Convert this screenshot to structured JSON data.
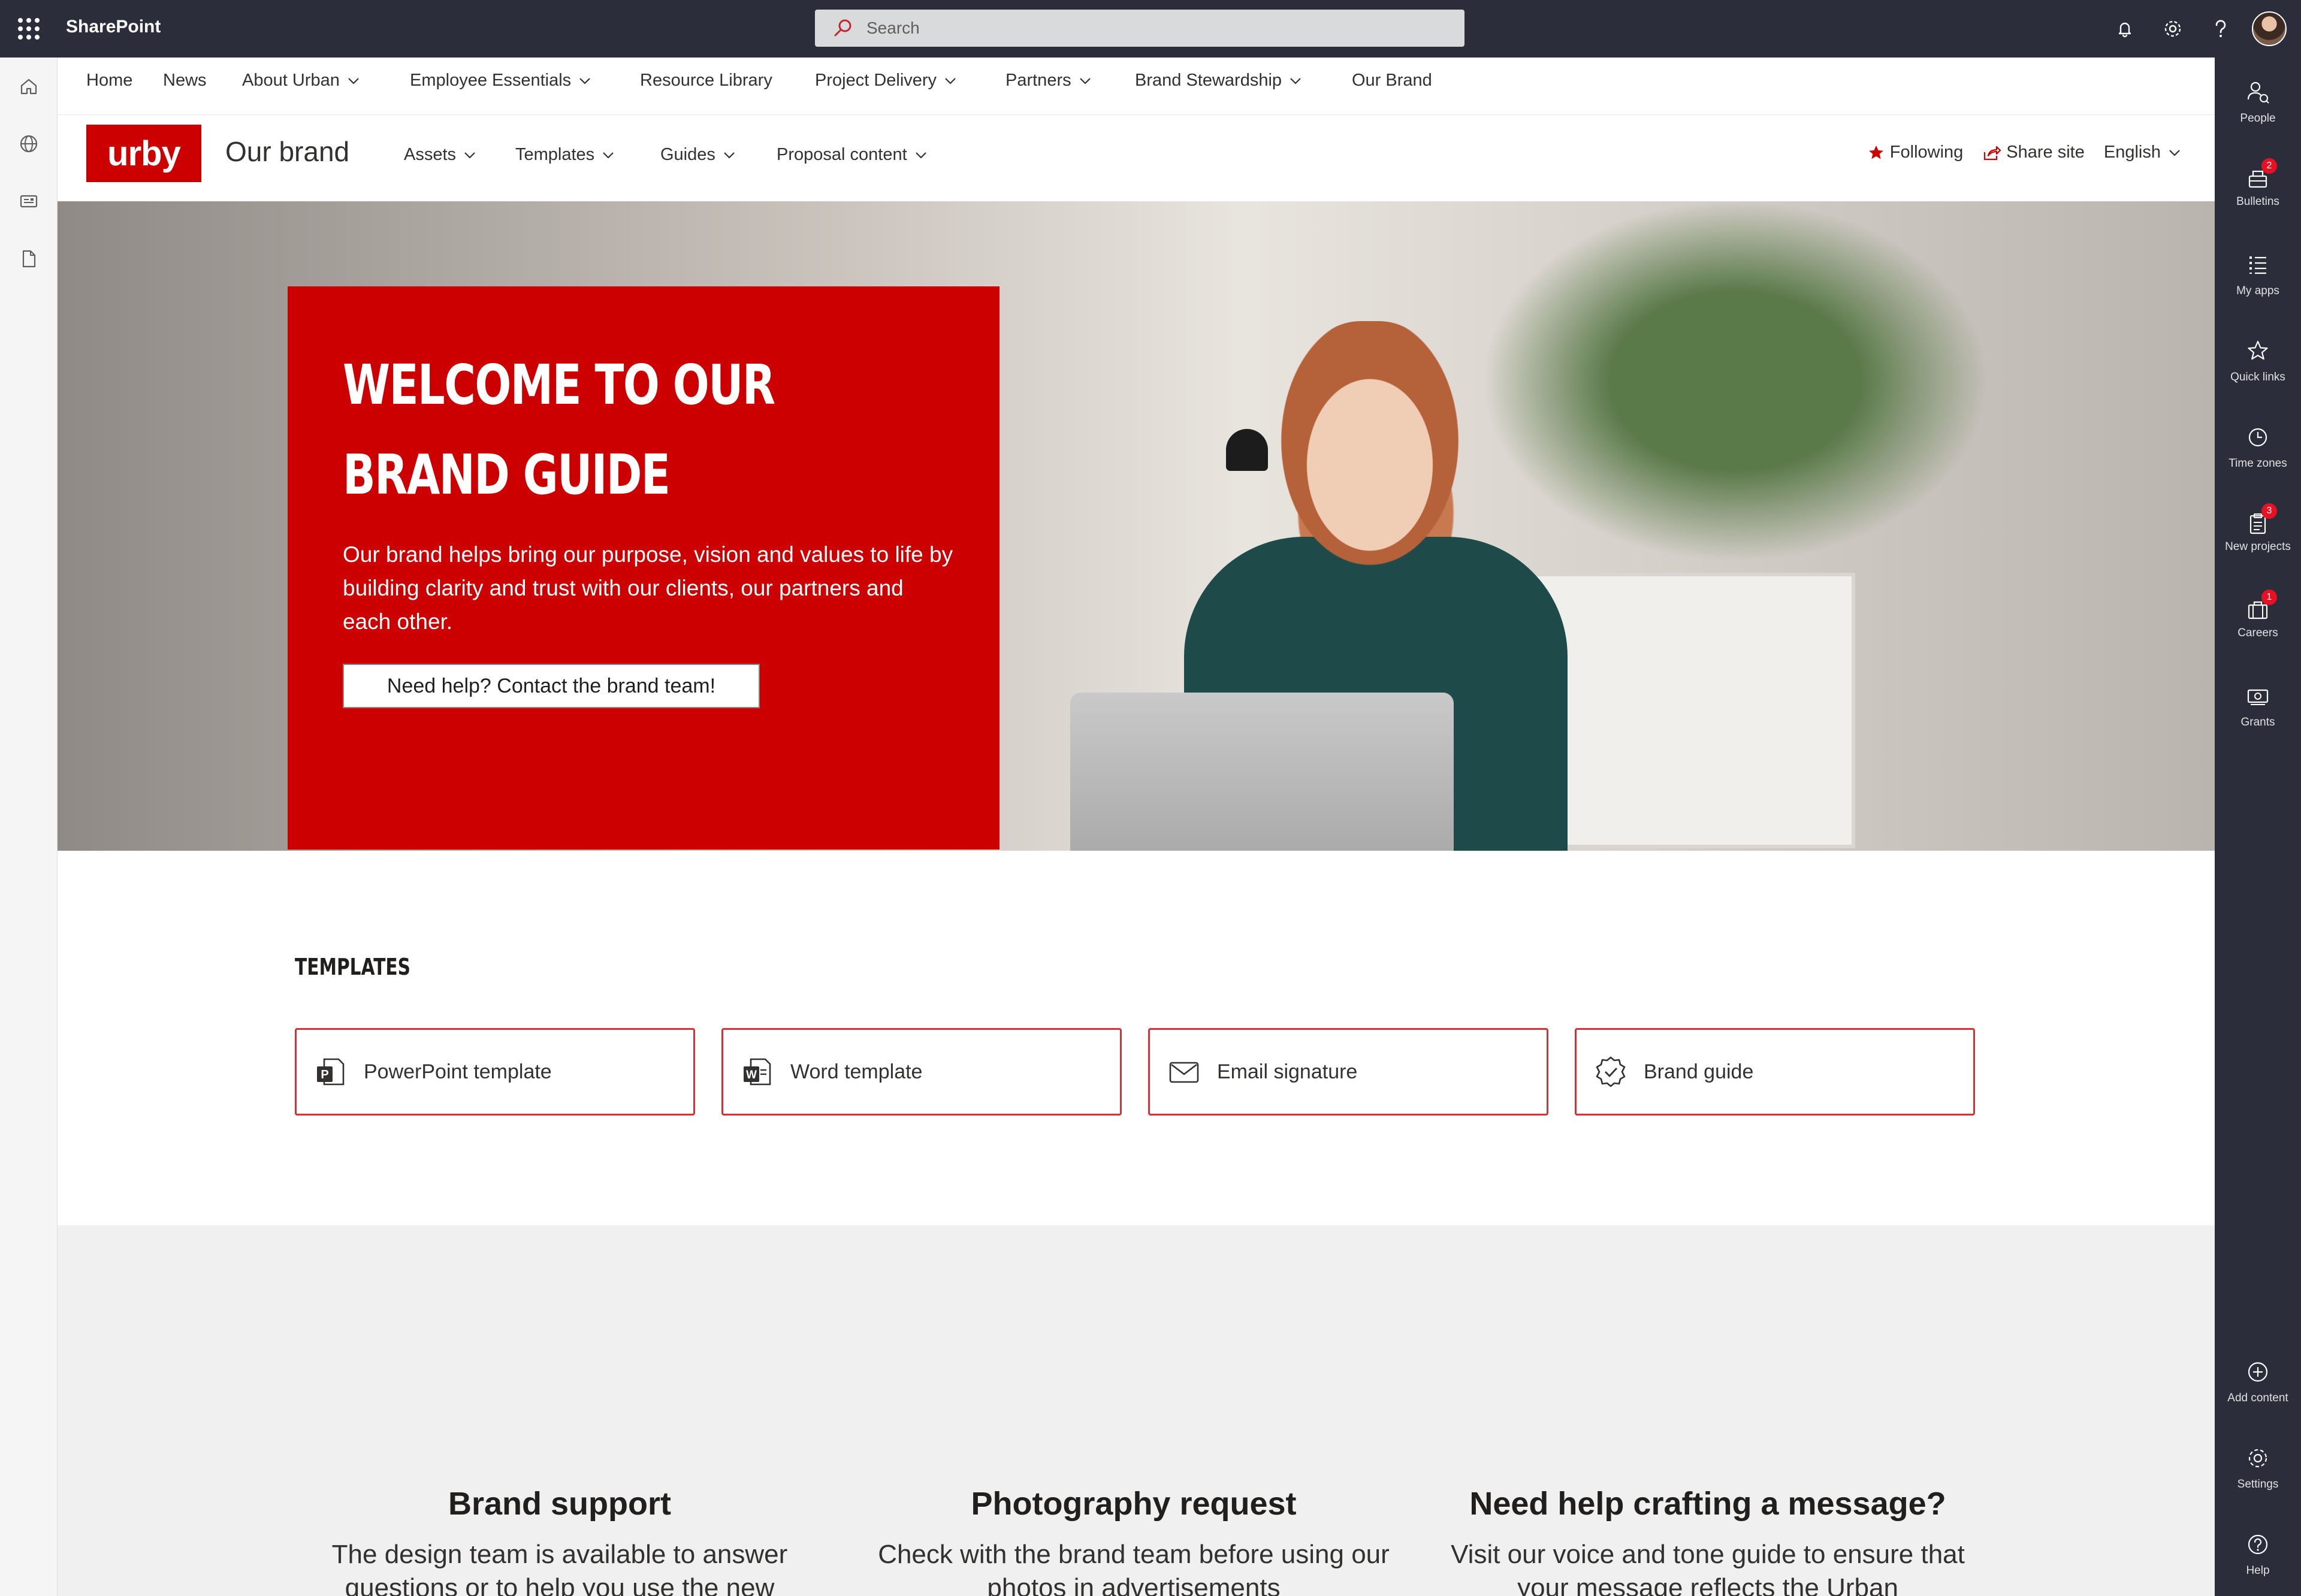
{
  "suite": {
    "app_name": "SharePoint",
    "search_placeholder": "Search"
  },
  "hub_nav": {
    "items": [
      {
        "label": "Home",
        "has_dropdown": false
      },
      {
        "label": "News",
        "has_dropdown": false
      },
      {
        "label": "About Urban",
        "has_dropdown": true
      },
      {
        "label": "Employee Essentials",
        "has_dropdown": true
      },
      {
        "label": "Resource Library",
        "has_dropdown": false
      },
      {
        "label": "Project Delivery",
        "has_dropdown": true
      },
      {
        "label": "Partners",
        "has_dropdown": true
      },
      {
        "label": "Brand Stewardship",
        "has_dropdown": true
      },
      {
        "label": "Our Brand",
        "has_dropdown": false
      }
    ]
  },
  "site": {
    "logo_text": "urby",
    "title": "Our brand",
    "nav": [
      {
        "label": "Assets"
      },
      {
        "label": "Templates"
      },
      {
        "label": "Guides"
      },
      {
        "label": "Proposal content"
      }
    ],
    "following_label": "Following",
    "share_label": "Share site",
    "language_label": "English"
  },
  "hero": {
    "title": "WELCOME TO OUR BRAND GUIDE",
    "text": "Our brand helps bring our purpose, vision and values to life by building clarity and trust with our clients, our partners and each other.",
    "button_label": "Need help? Contact the brand team!"
  },
  "templates": {
    "title": "TEMPLATES",
    "cards": [
      {
        "label": "PowerPoint template",
        "icon": "powerpoint-icon"
      },
      {
        "label": "Word template",
        "icon": "word-icon"
      },
      {
        "label": "Email signature",
        "icon": "mail-icon"
      },
      {
        "label": "Brand guide",
        "icon": "badge-check-icon"
      }
    ]
  },
  "support": {
    "columns": [
      {
        "title": "Brand support",
        "text": "The design team is available to answer questions or to help you use the new"
      },
      {
        "title": "Photography request",
        "text": "Check with the brand team before using our photos in advertisements"
      },
      {
        "title": "Need help crafting a message?",
        "text": "Visit our voice and tone guide to ensure that your message reflects the Urban"
      }
    ]
  },
  "app_bar": {
    "items": [
      {
        "label": "People",
        "icon": "people-icon",
        "badge": ""
      },
      {
        "label": "Bulletins",
        "icon": "bulletins-icon",
        "badge": "2"
      },
      {
        "label": "My apps",
        "icon": "my-apps-icon",
        "badge": ""
      },
      {
        "label": "Quick links",
        "icon": "star-icon",
        "badge": ""
      },
      {
        "label": "Time zones",
        "icon": "clock-icon",
        "badge": ""
      },
      {
        "label": "New projects",
        "icon": "clipboard-icon",
        "badge": "3"
      },
      {
        "label": "Careers",
        "icon": "briefcase-icon",
        "badge": "1"
      },
      {
        "label": "Grants",
        "icon": "money-icon",
        "badge": ""
      }
    ],
    "bottom": [
      {
        "label": "Add content",
        "icon": "add-circle-icon"
      },
      {
        "label": "Settings",
        "icon": "gear-icon"
      },
      {
        "label": "Help",
        "icon": "help-circle-icon"
      }
    ]
  },
  "colors": {
    "brand_red": "#cc0000",
    "suite_bar": "#2b2d3a",
    "card_border": "#d13438",
    "badge": "#e81123"
  }
}
